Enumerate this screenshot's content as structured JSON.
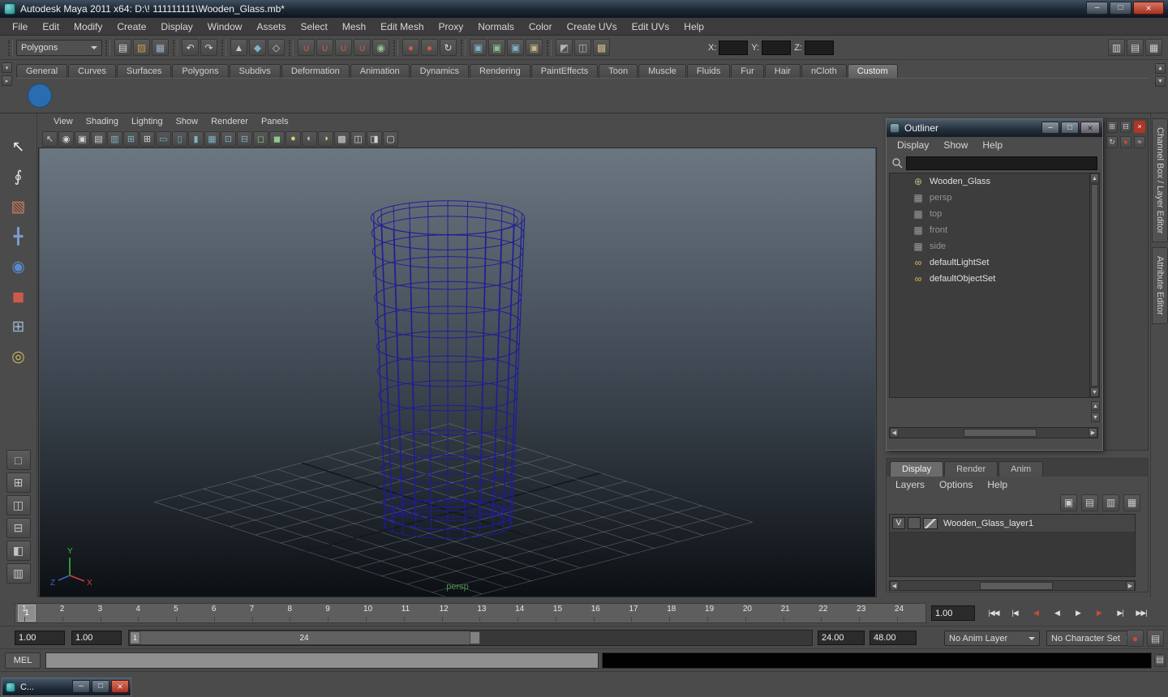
{
  "titlebar": {
    "title": "Autodesk Maya 2011 x64: D:\\! 111111111\\Wooden_Glass.mb*",
    "window_buttons": [
      {
        "n": "minimize-button",
        "g": "–"
      },
      {
        "n": "maximize-button",
        "g": "□"
      },
      {
        "n": "close-button",
        "g": "×",
        "cls": "close"
      }
    ]
  },
  "menubar": {
    "items": [
      "File",
      "Edit",
      "Modify",
      "Create",
      "Display",
      "Window",
      "Assets",
      "Select",
      "Mesh",
      "Edit Mesh",
      "Proxy",
      "Normals",
      "Color",
      "Create UVs",
      "Edit UVs",
      "Help"
    ]
  },
  "statusline": {
    "selection_mode": "Polygons",
    "icon_groups": [
      [
        {
          "n": "new-scene-icon",
          "g": "▤",
          "c": "#dcdcdc"
        },
        {
          "n": "open-scene-icon",
          "g": "▨",
          "c": "#c89a3e"
        },
        {
          "n": "save-scene-icon",
          "g": "▦",
          "c": "#9ab0c4"
        }
      ],
      [
        {
          "n": "undo-icon",
          "g": "↶",
          "c": "#d6d6d6"
        },
        {
          "n": "redo-icon",
          "g": "↷",
          "c": "#d6d6d6"
        }
      ],
      [
        {
          "n": "select-by-hierarchy-icon",
          "g": "▲",
          "c": "#c8c8c8"
        },
        {
          "n": "select-by-object-icon",
          "g": "◆",
          "c": "#7fb2c8"
        },
        {
          "n": "select-by-component-icon",
          "g": "◇",
          "c": "#c8c8c8"
        }
      ],
      [
        {
          "n": "snap-to-grid-icon",
          "g": "∪",
          "c": "#cc5a48"
        },
        {
          "n": "snap-to-curve-icon",
          "g": "∪",
          "c": "#cc5a48"
        },
        {
          "n": "snap-to-point-icon",
          "g": "∪",
          "c": "#cc5a48"
        },
        {
          "n": "snap-to-view-plane-icon",
          "g": "∪",
          "c": "#cc5a48"
        },
        {
          "n": "make-live-icon",
          "g": "◉",
          "c": "#94c094"
        }
      ],
      [
        {
          "n": "input-connections-icon",
          "g": "●",
          "c": "#cc5a48"
        },
        {
          "n": "output-connections-icon",
          "g": "●",
          "c": "#cc5a48"
        },
        {
          "n": "construction-history-icon",
          "g": "↻",
          "c": "#d6d6d6"
        }
      ],
      [
        {
          "n": "render-view-icon",
          "g": "▣",
          "c": "#7fb2c8"
        },
        {
          "n": "render-current-frame-icon",
          "g": "▣",
          "c": "#8fbc8f"
        },
        {
          "n": "ipr-render-icon",
          "g": "▣",
          "c": "#7fb2c8"
        },
        {
          "n": "render-settings-icon",
          "g": "▣",
          "c": "#c8b87f"
        }
      ],
      [
        {
          "n": "hypershade-icon",
          "g": "◩",
          "c": "#b4b4b4"
        },
        {
          "n": "hypergraph-icon",
          "g": "◫",
          "c": "#b4b4b4"
        },
        {
          "n": "content-browser-icon",
          "g": "▩",
          "c": "#c8b87f"
        }
      ]
    ],
    "coord_labels": [
      "X:",
      "Y:",
      "Z:"
    ],
    "icons_right": [
      {
        "n": "attribute-editor-toggle-icon",
        "g": "▥",
        "c": "#cfcfcf"
      },
      {
        "n": "tool-settings-toggle-icon",
        "g": "▤",
        "c": "#cfcfcf"
      },
      {
        "n": "channel-box-toggle-icon",
        "g": "▦",
        "c": "#cfcfcf"
      }
    ]
  },
  "shelf": {
    "tabs": [
      "General",
      "Curves",
      "Surfaces",
      "Polygons",
      "Subdivs",
      "Deformation",
      "Animation",
      "Dynamics",
      "Rendering",
      "PaintEffects",
      "Toon",
      "Muscle",
      "Fluids",
      "Fur",
      "Hair",
      "nCloth",
      "Custom"
    ],
    "active_index": 16,
    "items": [
      {
        "n": "polysphere-shelf-item",
        "g": "",
        "cls": "shelf-sphere"
      }
    ],
    "side_buttons": [
      {
        "n": "shelf-menu-icon",
        "g": "▾"
      },
      {
        "n": "shelf-tab-arrow-icon",
        "g": "▸"
      }
    ],
    "scroll_buttons": [
      {
        "n": "shelf-scroll-up-icon",
        "g": "▲"
      },
      {
        "n": "shelf-scroll-down-icon",
        "g": "▼"
      }
    ]
  },
  "toolbox": {
    "tools": [
      {
        "n": "select-tool-icon",
        "g": "↖",
        "c": "#ececec"
      },
      {
        "n": "lasso-tool-icon",
        "g": "∮",
        "c": "#e0e0e0"
      },
      {
        "n": "paint-selection-tool-icon",
        "g": "▧",
        "c": "#cc7a5a"
      },
      {
        "n": "move-tool-icon",
        "g": "╋",
        "c": "#7a9ccc"
      },
      {
        "n": "rotate-tool-icon",
        "g": "◉",
        "c": "#5a8acc"
      },
      {
        "n": "scale-tool-icon",
        "g": "◼",
        "c": "#cc5a4a"
      },
      {
        "n": "universal-manipulator-icon",
        "g": "⊞",
        "c": "#9ab0c8"
      },
      {
        "n": "soft-modification-icon",
        "g": "◎",
        "c": "#c8b85a"
      },
      {
        "n": "last-tool-icon",
        "g": "",
        "c": "#888888"
      }
    ],
    "layouts": [
      {
        "n": "single-pane-layout-icon",
        "g": "□"
      },
      {
        "n": "four-pane-layout-icon",
        "g": "⊞"
      },
      {
        "n": "two-pane-side-layout-icon",
        "g": "◫"
      },
      {
        "n": "two-pane-stacked-layout-icon",
        "g": "⊟"
      },
      {
        "n": "persp-outliner-layout-icon",
        "g": "◧"
      },
      {
        "n": "hypershade-persp-layout-icon",
        "g": "▥"
      }
    ]
  },
  "viewport": {
    "menus": [
      "View",
      "Shading",
      "Lighting",
      "Show",
      "Renderer",
      "Panels"
    ],
    "icons": [
      {
        "n": "select-camera-icon",
        "g": "↖",
        "c": "#d4d4d4"
      },
      {
        "n": "lock-camera-icon",
        "g": "◉",
        "c": "#d4d4d4"
      },
      {
        "n": "camera-attributes-icon",
        "g": "▣",
        "c": "#d4d4d4"
      },
      {
        "n": "bookmarks-icon",
        "g": "▤",
        "c": "#d4d4d4"
      },
      {
        "n": "image-plane-icon",
        "g": "▥",
        "c": "#7fb2c8"
      },
      {
        "n": "two-d-pan-zoom-icon",
        "g": "⊞",
        "c": "#7fb2c8"
      },
      {
        "n": "grid-toggle-icon",
        "g": "⊞",
        "c": "#d4d4d4"
      },
      {
        "n": "film-gate-icon",
        "g": "▭",
        "c": "#7fb2c8"
      },
      {
        "n": "resolution-gate-icon",
        "g": "▯",
        "c": "#7fb2c8"
      },
      {
        "n": "gate-mask-icon",
        "g": "▮",
        "c": "#7fb2c8"
      },
      {
        "n": "field-chart-icon",
        "g": "▦",
        "c": "#7fb2c8"
      },
      {
        "n": "safe-action-icon",
        "g": "⊡",
        "c": "#7fb2c8"
      },
      {
        "n": "safe-title-icon",
        "g": "⊟",
        "c": "#7fb2c8"
      },
      {
        "n": "frame-all-icon",
        "g": "◻",
        "c": "#8fc88f"
      },
      {
        "n": "frame-selection-icon",
        "g": "◼",
        "c": "#8fc88f"
      },
      {
        "n": "default-lighting-icon",
        "g": "●",
        "c": "#e0cc70"
      },
      {
        "n": "all-lights-icon",
        "g": "◐",
        "c": "#c4c4c4"
      },
      {
        "n": "shadows-icon",
        "g": "◑",
        "c": "#e0cc70"
      },
      {
        "n": "textured-display-icon",
        "g": "▩",
        "c": "#d4d4d4"
      },
      {
        "n": "wireframe-display-icon",
        "g": "◫",
        "c": "#d4d4d4"
      },
      {
        "n": "xray-display-icon",
        "g": "◨",
        "c": "#d4d4d4"
      },
      {
        "n": "isolate-select-icon",
        "g": "▢",
        "c": "#d4d4d4"
      }
    ],
    "camera_label": "persp",
    "axis_labels": {
      "x": "X",
      "y": "Y",
      "z": "Z"
    }
  },
  "pane_controls": {
    "top": [
      {
        "n": "pane-menu-icon",
        "g": "⊞",
        "c": "#cccccc"
      },
      {
        "n": "tear-off-copy-icon",
        "g": "⊟",
        "c": "#cccccc"
      },
      {
        "n": "close-pane-icon",
        "g": "×",
        "c": "#ffffff",
        "bg": "#b03626"
      }
    ],
    "side": [
      {
        "n": "sync-channel-icon",
        "g": "↻",
        "c": "#cccccc"
      },
      {
        "n": "key-channel-icon",
        "g": "●",
        "c": "#cc4a3a"
      },
      {
        "n": "channel-graph-icon",
        "g": "≈",
        "c": "#cccccc"
      }
    ]
  },
  "outliner": {
    "title": "Outliner",
    "window_buttons": [
      {
        "n": "outliner-minimize-button",
        "g": "–"
      },
      {
        "n": "outliner-maximize-button",
        "g": "□"
      },
      {
        "n": "outliner-close-button",
        "g": "×",
        "cls": "close"
      }
    ],
    "menus": [
      "Display",
      "Show",
      "Help"
    ],
    "items": [
      {
        "label": "Wooden_Glass",
        "icon": "transform-icon",
        "glyph": "⊕",
        "ic": "#b8b87a",
        "dim": false
      },
      {
        "label": "persp",
        "icon": "camera-icon",
        "glyph": "▦",
        "ic": "#9a9a9a",
        "dim": true
      },
      {
        "label": "top",
        "icon": "camera-icon",
        "glyph": "▦",
        "ic": "#9a9a9a",
        "dim": true
      },
      {
        "label": "front",
        "icon": "camera-icon",
        "glyph": "▦",
        "ic": "#9a9a9a",
        "dim": true
      },
      {
        "label": "side",
        "icon": "camera-icon",
        "glyph": "▦",
        "ic": "#9a9a9a",
        "dim": true
      },
      {
        "label": "defaultLightSet",
        "icon": "set-icon",
        "glyph": "∞",
        "ic": "#d8c05a",
        "dim": false
      },
      {
        "label": "defaultObjectSet",
        "icon": "set-icon",
        "glyph": "∞",
        "ic": "#d8c05a",
        "dim": false
      }
    ]
  },
  "side_tabs": [
    "Channel Box / Layer Editor",
    "Attribute Editor"
  ],
  "layer_editor": {
    "tabs": [
      "Display",
      "Render",
      "Anim"
    ],
    "active_index": 0,
    "menus": [
      "Layers",
      "Options",
      "Help"
    ],
    "icons": [
      {
        "n": "edit-layer-icon",
        "g": "▣",
        "c": "#c8c8c8"
      },
      {
        "n": "new-empty-layer-icon",
        "g": "▤",
        "c": "#c8c8c8"
      },
      {
        "n": "new-layer-icon",
        "g": "▥",
        "c": "#c8c8c8"
      },
      {
        "n": "new-layer-from-selected-icon",
        "g": "▦",
        "c": "#c8c8c8"
      }
    ],
    "layers": [
      {
        "visibility": "V",
        "name": "Wooden_Glass_layer1"
      }
    ]
  },
  "timeline": {
    "ticks": [
      "1",
      "2",
      "3",
      "4",
      "5",
      "6",
      "7",
      "8",
      "9",
      "10",
      "11",
      "12",
      "13",
      "14",
      "15",
      "16",
      "17",
      "18",
      "19",
      "20",
      "21",
      "22",
      "23",
      "24"
    ],
    "current_frame": "1",
    "current_time": "1.00",
    "playback": [
      {
        "n": "go-to-start-button",
        "g": "|◀◀",
        "c": "#dddddd"
      },
      {
        "n": "step-back-frame-button",
        "g": "|◀",
        "c": "#dddddd"
      },
      {
        "n": "step-back-key-button",
        "g": "◀",
        "c": "#cc4a3a"
      },
      {
        "n": "play-backwards-button",
        "g": "◀",
        "c": "#dddddd"
      },
      {
        "n": "play-forwards-button",
        "g": "▶",
        "c": "#dddddd"
      },
      {
        "n": "step-forward-key-button",
        "g": "▶",
        "c": "#cc4a3a"
      },
      {
        "n": "step-forward-frame-button",
        "g": "▶|",
        "c": "#dddddd"
      },
      {
        "n": "go-to-end-button",
        "g": "▶▶|",
        "c": "#dddddd"
      }
    ]
  },
  "range_slider": {
    "anim_start": "1.00",
    "playback_start": "1.00",
    "thumb_start_label": "1",
    "thumb_end_label": "24",
    "playback_end": "24.00",
    "anim_end": "48.00",
    "anim_layer": "No Anim Layer",
    "character_set": "No Character Set",
    "right_icons": [
      {
        "n": "auto-keyframe-icon",
        "g": "●",
        "c": "#cc4a3a"
      },
      {
        "n": "animation-preferences-icon",
        "g": "▤",
        "c": "#cccccc"
      }
    ]
  },
  "command_line": {
    "label": "MEL"
  },
  "cmd_icon": {
    "n": "script-editor-icon",
    "g": "▤",
    "c": "#cccccc"
  },
  "taskbar": {
    "minimized_title": "C...",
    "buttons": [
      {
        "n": "taskwin-minimize-button",
        "g": "–"
      },
      {
        "n": "taskwin-maximize-button",
        "g": "□"
      },
      {
        "n": "taskwin-close-button",
        "g": "×",
        "cls": "close"
      }
    ]
  }
}
